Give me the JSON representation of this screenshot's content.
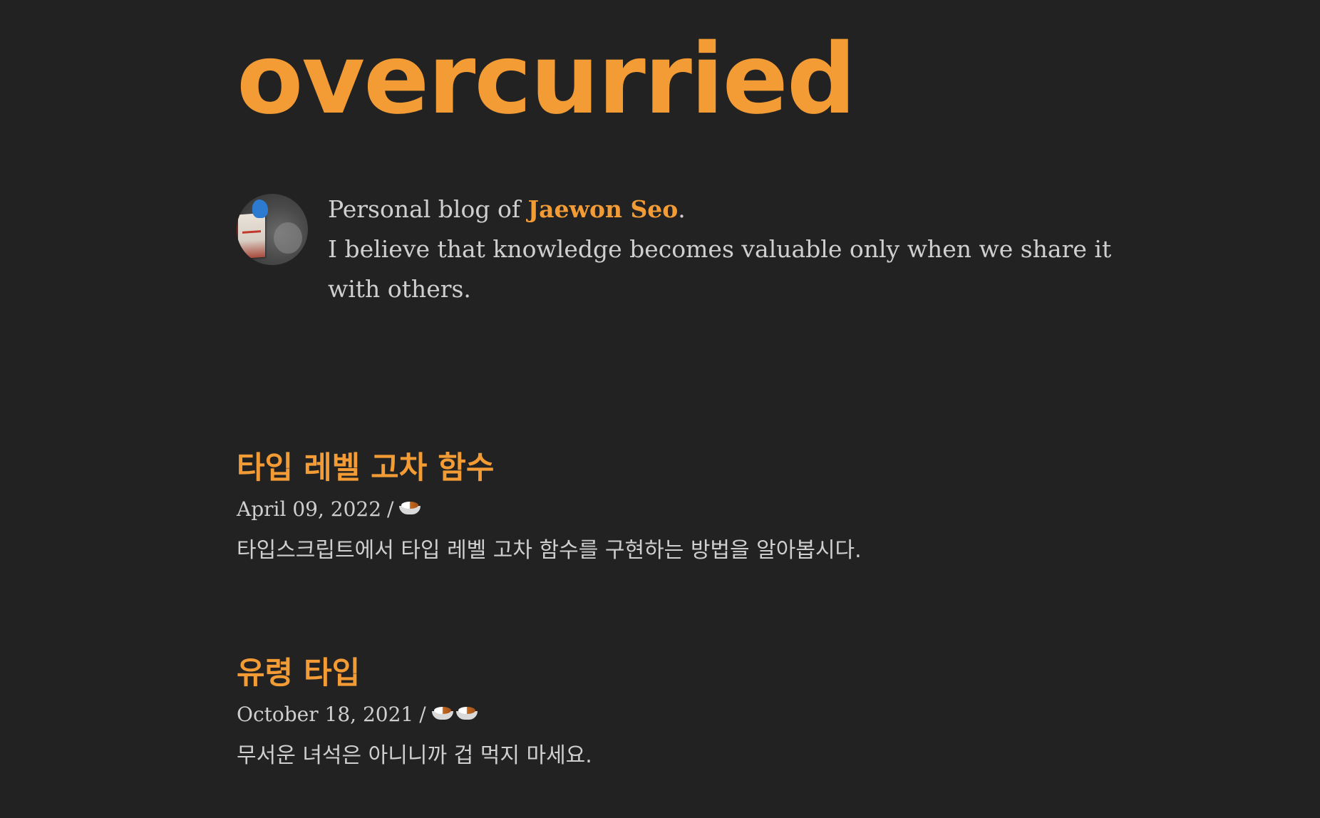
{
  "header": {
    "site_title": "overcurried"
  },
  "bio": {
    "line1_prefix": "Personal blog of ",
    "author_name": "Jaewon Seo",
    "line1_suffix": ".",
    "line2": "I believe that knowledge becomes valuable only when we share it with others."
  },
  "posts": [
    {
      "title": "타입 레벨 고차 함수",
      "date": "April 09, 2022",
      "separator": "/",
      "curry_rating": 1,
      "icon": "curry-rice-icon",
      "description": "타입스크립트에서 타입 레벨 고차 함수를 구현하는 방법을 알아봅시다."
    },
    {
      "title": "유령 타입",
      "date": "October 18, 2021",
      "separator": "/",
      "curry_rating": 2,
      "icon": "curry-rice-icon",
      "description": "무서운 녀석은 아니니까 겁 먹지 마세요."
    }
  ],
  "colors": {
    "background": "#222222",
    "accent": "#f39c35",
    "text": "#cfcfcf"
  }
}
